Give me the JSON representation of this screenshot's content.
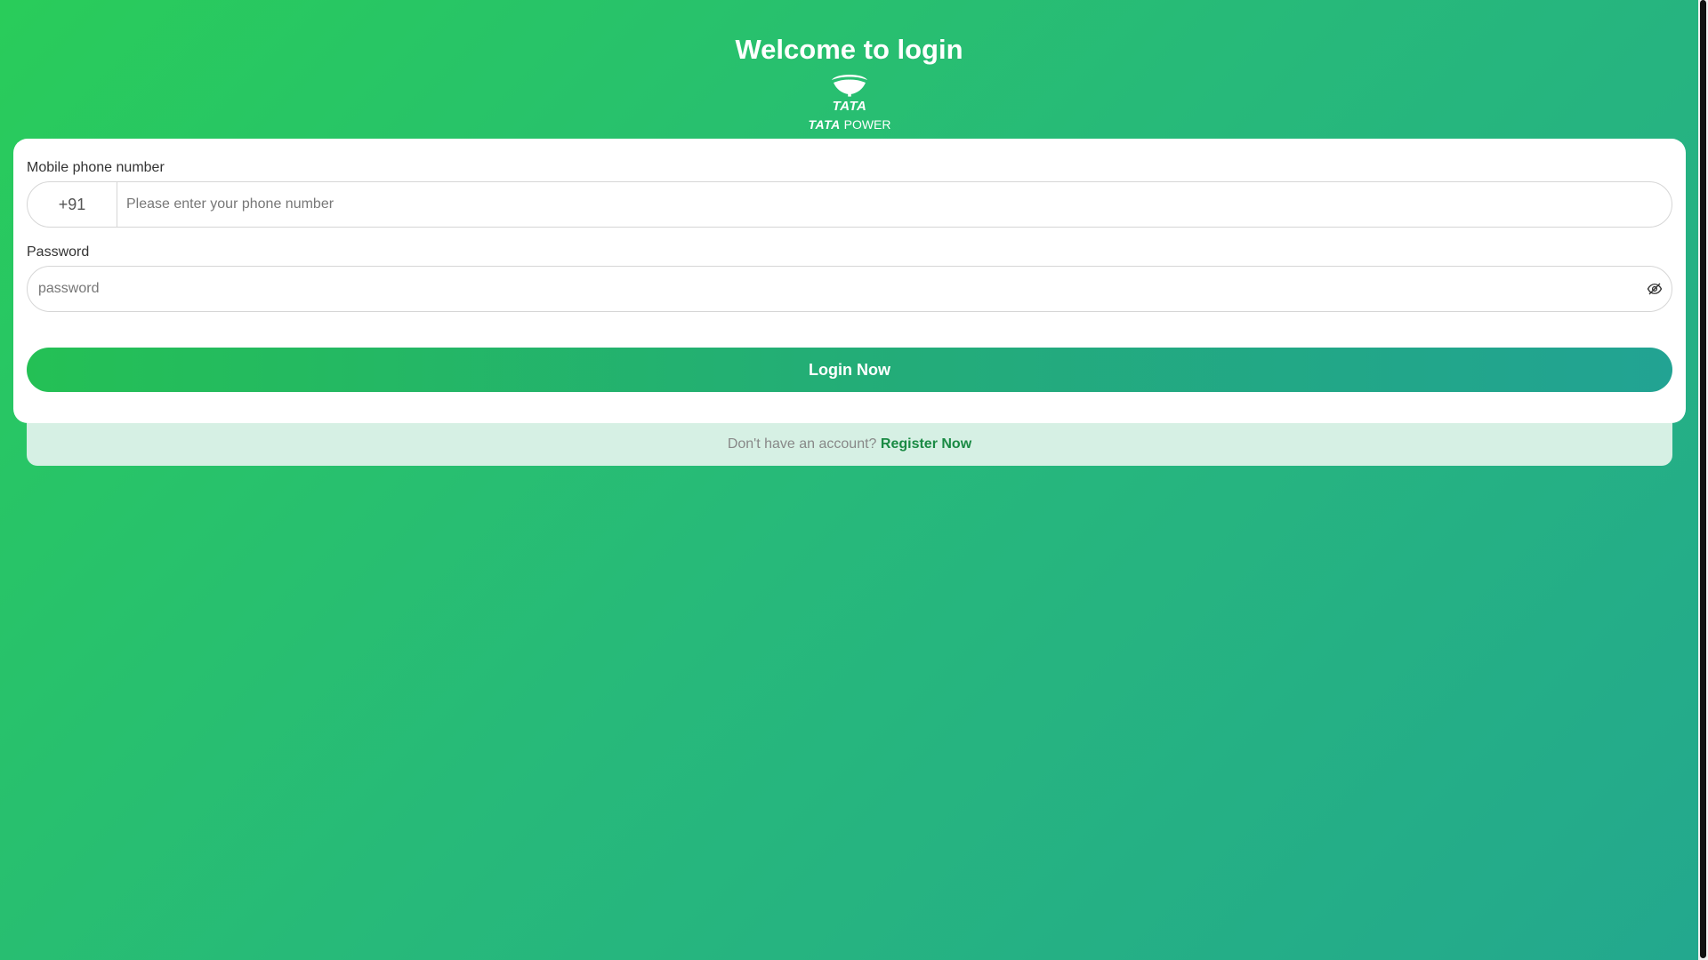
{
  "page": {
    "title": "Welcome to login"
  },
  "logo": {
    "mark_text": "TATA",
    "brand_bold": "TATA",
    "brand_rest": "POWER"
  },
  "form": {
    "phone_label": "Mobile phone number",
    "country_code": "+91",
    "phone_placeholder": "Please enter your phone number",
    "phone_value": "",
    "password_label": "Password",
    "password_placeholder": "password",
    "password_value": "",
    "password_toggle_icon": "eye-icon",
    "submit_label": "Login Now"
  },
  "register": {
    "prompt": "Don't have an account?",
    "link_label": "Register Now"
  },
  "colors": {
    "background_start": "#29cc5a",
    "background_end": "#23a88e",
    "register_link": "#1a8a44",
    "register_bar": "#d6f0e4"
  }
}
